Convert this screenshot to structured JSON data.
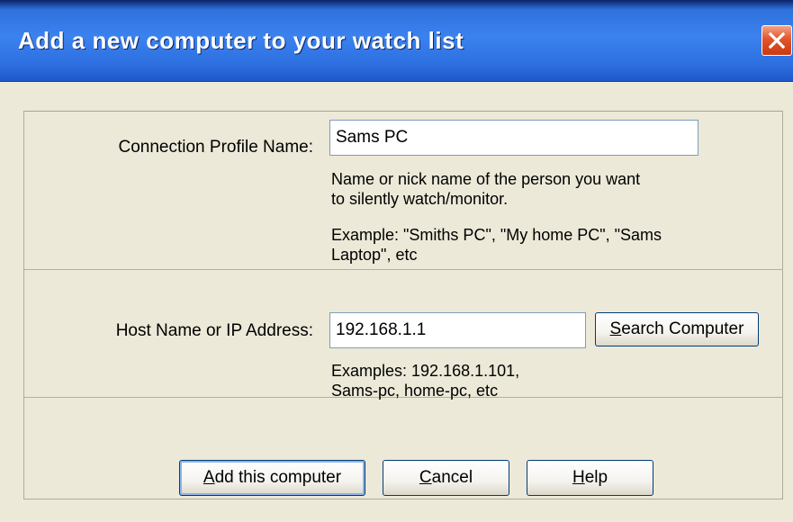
{
  "window": {
    "title": "Add a new computer to your watch list",
    "close_icon": "close-x-icon"
  },
  "profile": {
    "label": "Connection Profile Name:",
    "value": "Sams PC",
    "hint_line1": "Name or nick name of the person you want",
    "hint_line2": "to silently watch/monitor.",
    "example_line1": "Example: \"Smiths PC\", \"My home PC\", \"Sams",
    "example_line2": "Laptop\", etc"
  },
  "host": {
    "label": "Host Name or IP Address:",
    "value": "192.168.1.1",
    "search_button_key": "S",
    "search_button_rest": "earch Computer",
    "examples_line1": "Examples: 192.168.1.101,",
    "examples_line2": "Sams-pc,  home-pc, etc"
  },
  "buttons": {
    "add_key": "A",
    "add_rest": "dd this computer",
    "cancel_key": "C",
    "cancel_rest": "ancel",
    "help_key": "H",
    "help_rest": "elp"
  },
  "colors": {
    "titlebar": "#2f71dd",
    "close_button": "#e3542a",
    "dialog_bg": "#ece9d8"
  }
}
